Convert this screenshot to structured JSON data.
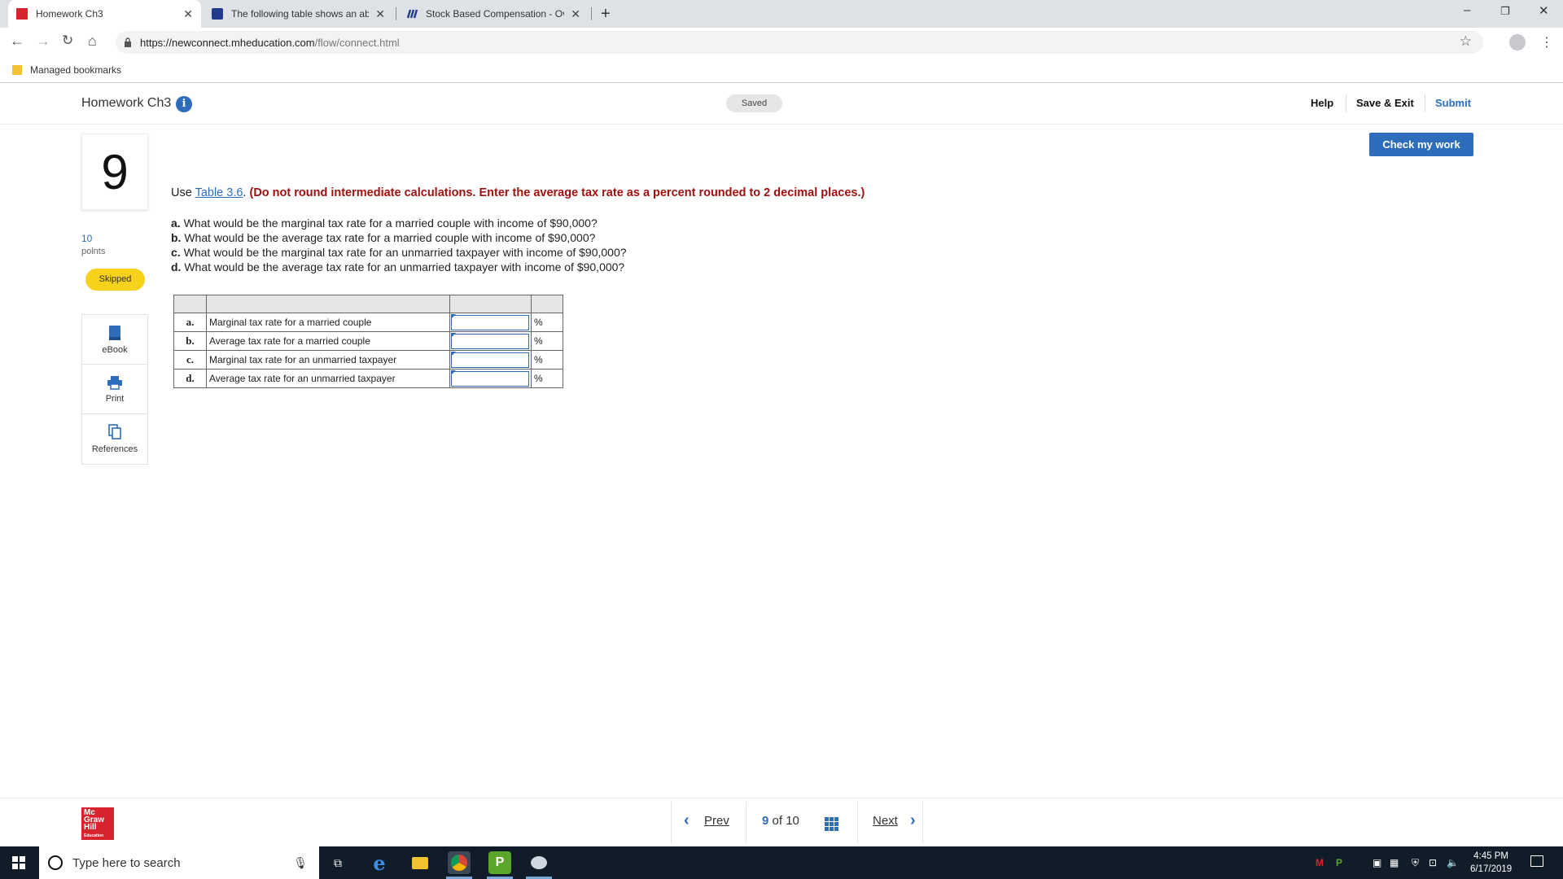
{
  "browser": {
    "tabs": [
      {
        "title": "Homework Ch3",
        "active": true
      },
      {
        "title": "The following table shows an abl",
        "active": false
      },
      {
        "title": "Stock Based Compensation - Ove",
        "active": false
      }
    ],
    "new_tab_label": "+",
    "url_host": "https://newconnect.mheducation.com",
    "url_path": "/flow/connect.html",
    "bookmarks_folder": "Managed bookmarks",
    "window_controls": [
      "–",
      "❐",
      "✕"
    ]
  },
  "header": {
    "assignment_title": "Homework Ch3",
    "info_icon_glyph": "i",
    "saved_status": "Saved",
    "help": "Help",
    "save_exit": "Save & Exit",
    "submit": "Submit",
    "check_my_work": "Check my work"
  },
  "question": {
    "number": "9",
    "points_value": "10",
    "points_label": "points",
    "status": "Skipped",
    "instruction_prefix": "Use ",
    "table_link": "Table 3.6",
    "instruction_mid": ". ",
    "instruction_warning": "(Do not round intermediate calculations. Enter the average tax rate as a percent rounded to 2 decimal places.)",
    "parts": [
      {
        "letter": "a.",
        "text": " What would be the marginal tax rate for a married couple with income of $90,000?"
      },
      {
        "letter": "b.",
        "text": " What would be the average tax rate for a married couple with income of $90,000?"
      },
      {
        "letter": "c.",
        "text": " What would be the marginal tax rate for an unmarried taxpayer with income of $90,000?"
      },
      {
        "letter": "d.",
        "text": " What would be the average tax rate for an unmarried taxpayer with income of $90,000?"
      }
    ],
    "answer_rows": [
      {
        "letter": "a.",
        "label": "Marginal tax rate for a married couple",
        "value": "",
        "unit": "%"
      },
      {
        "letter": "b.",
        "label": "Average tax rate for a married couple",
        "value": "",
        "unit": "%"
      },
      {
        "letter": "c.",
        "label": "Marginal tax rate for an unmarried taxpayer",
        "value": "",
        "unit": "%"
      },
      {
        "letter": "d.",
        "label": "Average tax rate for an unmarried taxpayer",
        "value": "",
        "unit": "%"
      }
    ]
  },
  "tools": [
    {
      "label": "eBook",
      "icon": "book-icon"
    },
    {
      "label": "Print",
      "icon": "printer-icon"
    },
    {
      "label": "References",
      "icon": "copy-icon"
    }
  ],
  "footer": {
    "logo_lines": [
      "Mc",
      "Graw",
      "Hill"
    ],
    "logo_sub": "Education",
    "prev": "Prev",
    "current_page": "9",
    "of": "of",
    "total_pages": "10",
    "next": "Next"
  },
  "taskbar": {
    "search_placeholder": "Type here to search",
    "time": "4:45 PM",
    "date": "6/17/2019"
  },
  "colors": {
    "accent": "#2e6dbc",
    "warning": "#a01010",
    "skipped_badge": "#f7d21a",
    "brand_red": "#d6232e"
  }
}
